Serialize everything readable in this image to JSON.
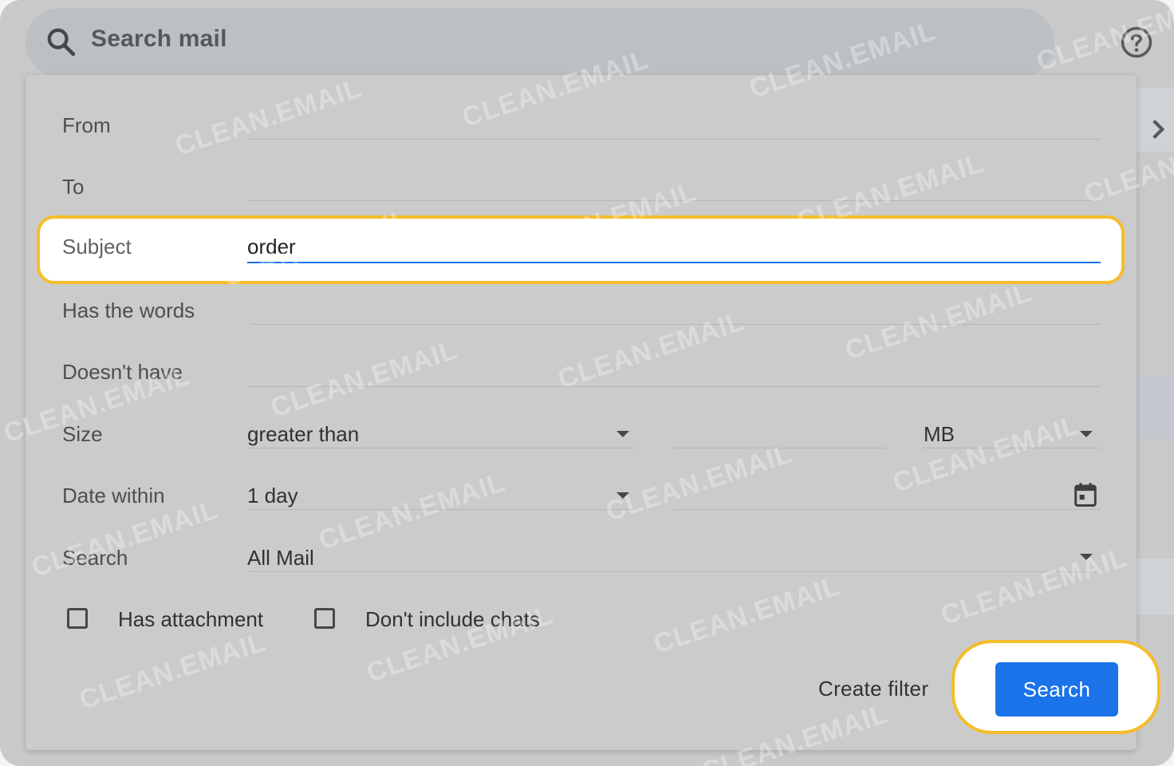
{
  "search_bar": {
    "placeholder": "Search mail"
  },
  "form": {
    "from_label": "From",
    "to_label": "To",
    "subject_label": "Subject",
    "subject_value": "order",
    "has_words_label": "Has the words",
    "doesnt_have_label": "Doesn't have",
    "size_label": "Size",
    "size_operator": "greater than",
    "size_unit": "MB",
    "date_within_label": "Date within",
    "date_within_value": "1 day",
    "search_label": "Search",
    "search_scope": "All Mail",
    "has_attachment_label": "Has attachment",
    "dont_include_chats_label": "Don't include chats"
  },
  "actions": {
    "create_filter": "Create filter",
    "search": "Search"
  },
  "watermark_text": "CLEAN.EMAIL",
  "colors": {
    "highlight": "#f5bd2b",
    "primary_button": "#1a73e8"
  }
}
